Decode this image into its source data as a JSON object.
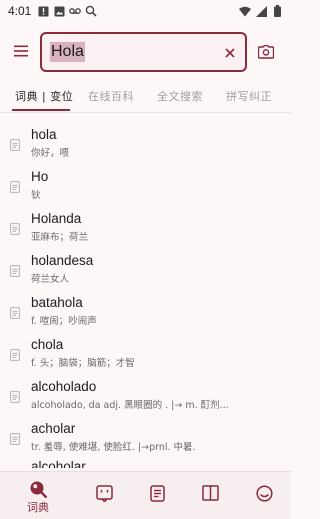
{
  "status_bar": {
    "time": "4:01",
    "left_icons": [
      "alert-icon",
      "gallery-icon",
      "voicemail-icon",
      "search-status-icon"
    ],
    "right_icons": [
      "wifi-icon",
      "signal-icon",
      "battery-icon"
    ]
  },
  "search": {
    "value": "Hola",
    "menu_icon": "menu-icon",
    "clear_icon": "close-icon",
    "camera_icon": "camera-icon"
  },
  "tabs": [
    {
      "label": "词典 | 变位",
      "active": true
    },
    {
      "label": "在线百科",
      "active": false
    },
    {
      "label": "全文搜索",
      "active": false
    },
    {
      "label": "拼写纠正",
      "active": false
    }
  ],
  "results": [
    {
      "word": "hola",
      "meaning": "你好，喂"
    },
    {
      "word": "Ho",
      "meaning": "钬"
    },
    {
      "word": "Holanda",
      "meaning": "亚麻布；荷兰"
    },
    {
      "word": "holandesa",
      "meaning": "荷兰女人"
    },
    {
      "word": "batahola",
      "meaning": "f. 喧闹；吵闹声"
    },
    {
      "word": "chola",
      "meaning": "f. 头；脑袋；脑筋；才智"
    },
    {
      "word": "alcoholado",
      "meaning": "alcoholado, da    adj. 黑眼圈的 .   |→ m.  酊剂..."
    },
    {
      "word": "acholar",
      "meaning": " tr.   羞辱, 使难堪, 使脸红.   |→prnl.   中暑."
    },
    {
      "word": "alcoholar",
      "meaning": ""
    }
  ],
  "bottom_nav": [
    {
      "icon": "search-nav-icon",
      "label": "词典",
      "active": true
    },
    {
      "icon": "translate-nav-icon",
      "label": "",
      "active": false
    },
    {
      "icon": "notes-nav-icon",
      "label": "",
      "active": false
    },
    {
      "icon": "book-nav-icon",
      "label": "",
      "active": false
    },
    {
      "icon": "profile-nav-icon",
      "label": "",
      "active": false
    }
  ],
  "colors": {
    "accent": "#8a2a3c",
    "background": "#fdf7f8",
    "search_highlight": "#d9b3bb",
    "muted_text": "#a89a9d"
  }
}
